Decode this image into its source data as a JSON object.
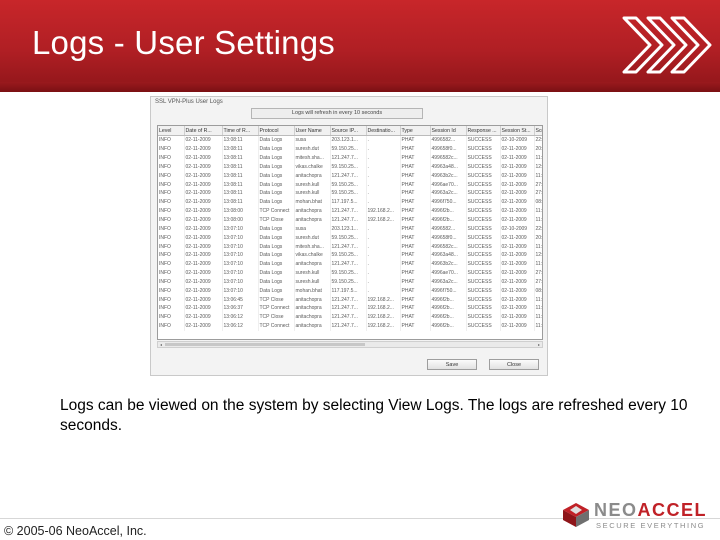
{
  "slide": {
    "title": "Logs - User Settings",
    "body": "Logs can be viewed on the system by selecting View Logs. The logs are refreshed every 10 seconds.",
    "copyright": "© 2005-06 NeoAccel, Inc.",
    "logo_name_1": "NEO",
    "logo_name_2": "ACCEL",
    "logo_tagline": "SECURE EVERYTHING",
    "colors": {
      "header": "#b01f24",
      "brand_red": "#c02127",
      "brand_gray": "#8b8b8b"
    }
  },
  "screenshot": {
    "window_title": "SSL VPN-Plus User Logs",
    "refresh_label": "Logs will refresh in every 10 seconds",
    "columns": [
      "Level",
      "Date of R...",
      "Time of R...",
      "Protocol",
      "User Name",
      "Source IP...",
      "Destinatio...",
      "Type",
      "Session Id",
      "Response ...",
      "Session St...",
      "Sco"
    ],
    "rows": [
      [
        "INFO",
        "02-11-2009",
        "13:08:11",
        "Data Logs",
        "susa",
        "203.123.1...",
        ".",
        "PHAT",
        "4996582...",
        "SUCCESS",
        "02-10-2009",
        "22:4"
      ],
      [
        "INFO",
        "02-11-2009",
        "13:08:11",
        "Data Logs",
        "suresh.dut",
        "59.150.25...",
        ".",
        "PHAT",
        "499658f0...",
        "SUCCESS",
        "02-11-2009",
        "20:4"
      ],
      [
        "INFO",
        "02-11-2009",
        "13:08:11",
        "Data Logs",
        "mitesh.sha...",
        "121.247.7...",
        ".",
        "PHAT",
        "4996582c...",
        "SUCCESS",
        "02-11-2009",
        "11:1"
      ],
      [
        "INFO",
        "02-11-2009",
        "13:08:11",
        "Data Logs",
        "vikas.chalke",
        "59.150.25...",
        ".",
        "PHAT",
        "49963a48...",
        "SUCCESS",
        "02-11-2009",
        "12:3"
      ],
      [
        "INFO",
        "02-11-2009",
        "13:08:11",
        "Data Logs",
        "anitachopra",
        "121.247.7...",
        ".",
        "PHAT",
        "49963b2c...",
        "SUCCESS",
        "02-11-2009",
        "11:1"
      ],
      [
        "INFO",
        "02-11-2009",
        "13:08:11",
        "Data Logs",
        "suresh.kull",
        "59.150.25...",
        ".",
        "PHAT",
        "4996ae70...",
        "SUCCESS",
        "02-11-2009",
        "27:2"
      ],
      [
        "INFO",
        "02-11-2009",
        "13:08:11",
        "Data Logs",
        "suresh.kull",
        "59.150.25...",
        ".",
        "PHAT",
        "49963a2c...",
        "SUCCESS",
        "02-11-2009",
        "27:2"
      ],
      [
        "INFO",
        "02-11-2009",
        "13:08:11",
        "Data Logs",
        "mohan.bhat",
        "117.197.5...",
        ".",
        "PHAT",
        "4996f750...",
        "SUCCESS",
        "02-11-2009",
        "08:1"
      ],
      [
        "INFO",
        "02-11-2009",
        "13:08:00",
        "TCP Connect",
        "anitachopra",
        "121.247.7...",
        "192.168.2...",
        "PHAT",
        "4996f2b...",
        "SUCCESS",
        "02-11-2009",
        "11:1"
      ],
      [
        "INFO",
        "02-11-2009",
        "13:08:00",
        "TCP Close",
        "anitachopra",
        "121.247.7...",
        "192.168.2...",
        "PHAT",
        "4996f2b...",
        "SUCCESS",
        "02-11-2009",
        "11:1"
      ],
      [
        "INFO",
        "02-11-2009",
        "13:07:10",
        "Data Logs",
        "susa",
        "203.123.1...",
        ".",
        "PHAT",
        "4996582...",
        "SUCCESS",
        "02-10-2009",
        "22:4"
      ],
      [
        "INFO",
        "02-11-2009",
        "13:07:10",
        "Data Logs",
        "suresh.dut",
        "59.150.25...",
        ".",
        "PHAT",
        "499658f0...",
        "SUCCESS",
        "02-11-2009",
        "20:4"
      ],
      [
        "INFO",
        "02-11-2009",
        "13:07:10",
        "Data Logs",
        "mitesh.sha...",
        "121.247.7...",
        ".",
        "PHAT",
        "4996582c...",
        "SUCCESS",
        "02-11-2009",
        "11:1"
      ],
      [
        "INFO",
        "02-11-2009",
        "13:07:10",
        "Data Logs",
        "vikas.chalke",
        "59.150.25...",
        ".",
        "PHAT",
        "49963a48...",
        "SUCCESS",
        "02-11-2009",
        "12:3"
      ],
      [
        "INFO",
        "02-11-2009",
        "13:07:10",
        "Data Logs",
        "anitachopra",
        "121.247.7...",
        ".",
        "PHAT",
        "49963b2c...",
        "SUCCESS",
        "02-11-2009",
        "11:1"
      ],
      [
        "INFO",
        "02-11-2009",
        "13:07:10",
        "Data Logs",
        "suresh.kull",
        "59.150.25...",
        ".",
        "PHAT",
        "4996ae70...",
        "SUCCESS",
        "02-11-2009",
        "27:2"
      ],
      [
        "INFO",
        "02-11-2009",
        "13:07:10",
        "Data Logs",
        "suresh.kull",
        "59.150.25...",
        ".",
        "PHAT",
        "49963a2c...",
        "SUCCESS",
        "02-11-2009",
        "27:2"
      ],
      [
        "INFO",
        "02-11-2009",
        "13:07:10",
        "Data Logs",
        "mohan.bhat",
        "117.197.5...",
        ".",
        "PHAT",
        "4996f750...",
        "SUCCESS",
        "02-11-2009",
        "08:1"
      ],
      [
        "INFO",
        "02-11-2009",
        "13:06:45",
        "TCP Close",
        "anitachopra",
        "121.247.7...",
        "192.168.2...",
        "PHAT",
        "4996f2b...",
        "SUCCESS",
        "02-11-2009",
        "11:1"
      ],
      [
        "INFO",
        "02-11-2009",
        "13:06:37",
        "TCP Connect",
        "anitachopra",
        "121.247.7...",
        "192.168.2...",
        "PHAT",
        "4996f2b...",
        "SUCCESS",
        "02-11-2009",
        "11:1"
      ],
      [
        "INFO",
        "02-11-2009",
        "13:06:12",
        "TCP Close",
        "anitachopra",
        "121.247.7...",
        "192.168.2...",
        "PHAT",
        "4996f2b...",
        "SUCCESS",
        "02-11-2009",
        "11:1"
      ],
      [
        "INFO",
        "02-11-2009",
        "13:06:12",
        "TCP Connect",
        "anitachopra",
        "121.247.7...",
        "192.168.2...",
        "PHAT",
        "4996f2b...",
        "SUCCESS",
        "02-11-2009",
        "11:1"
      ]
    ],
    "buttons": {
      "save": "Save",
      "close": "Close"
    }
  }
}
